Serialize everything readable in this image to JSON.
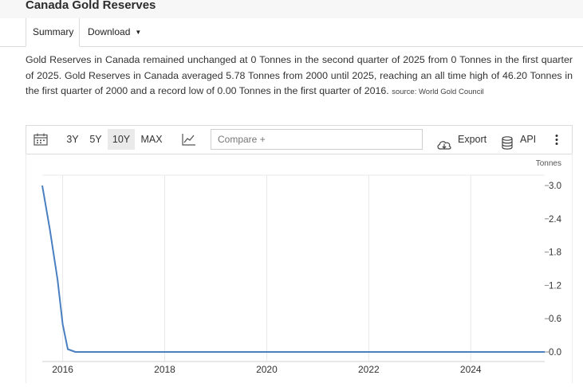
{
  "page": {
    "title": "Canada Gold Reserves"
  },
  "tabs": {
    "summary": "Summary",
    "download": "Download"
  },
  "summary": {
    "text": "Gold Reserves in Canada remained unchanged at 0 Tonnes in the second quarter of 2025 from 0 Tonnes in the first quarter of 2025. Gold Reserves in Canada averaged 5.78 Tonnes from 2000 until 2025, reaching an all time high of 46.20 Tonnes in the first quarter of 2000 and a record low of 0.00 Tonnes in the first quarter of 2016.",
    "source": "source: World Gold Council"
  },
  "toolbar": {
    "ranges": [
      "3Y",
      "5Y",
      "10Y",
      "MAX"
    ],
    "active_range": "10Y",
    "compare_placeholder": "Compare +",
    "export_label": "Export",
    "api_label": "API",
    "icons": {
      "calendar": "calendar-icon",
      "chart_type": "line-chart-icon",
      "export": "cloud-download-icon",
      "api": "database-icon",
      "more": "more-vertical-icon"
    }
  },
  "colors": {
    "line": "#4a7fc1",
    "grid": "#e8e8e8",
    "active_range_bg": "#eaeaea"
  },
  "chart_data": {
    "type": "line",
    "unit_label": "Tonnes",
    "axis_position": "right",
    "grid": true,
    "x_ticks": [
      "2016",
      "2018",
      "2020",
      "2022",
      "2024"
    ],
    "y_ticks": [
      "3.0",
      "2.4",
      "1.8",
      "1.2",
      "0.6",
      "0.0"
    ],
    "xlim": [
      2015.6,
      2025.45
    ],
    "ylim": [
      0,
      3.0
    ],
    "series": [
      {
        "x": [
          2015.6,
          2015.75,
          2015.9,
          2016.0,
          2016.1,
          2016.25,
          2017.0,
          2018.0,
          2019.0,
          2020.0,
          2021.0,
          2022.0,
          2023.0,
          2024.0,
          2025.0,
          2025.45
        ],
        "y": [
          3.0,
          2.2,
          1.3,
          0.5,
          0.05,
          0.0,
          0.0,
          0.0,
          0.0,
          0.0,
          0.0,
          0.0,
          0.0,
          0.0,
          0.0,
          0.0
        ]
      }
    ]
  }
}
